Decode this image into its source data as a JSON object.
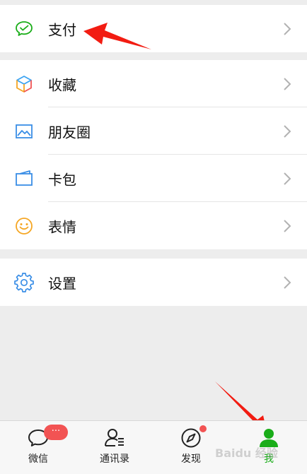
{
  "groups": [
    {
      "items": [
        {
          "label": "支付",
          "icon": "wechat-pay-icon"
        }
      ]
    },
    {
      "items": [
        {
          "label": "收藏",
          "icon": "favorites-cube-icon"
        },
        {
          "label": "朋友圈",
          "icon": "moments-picture-icon"
        },
        {
          "label": "卡包",
          "icon": "card-wallet-icon"
        },
        {
          "label": "表情",
          "icon": "smiley-face-icon"
        }
      ]
    },
    {
      "items": [
        {
          "label": "设置",
          "icon": "gear-icon"
        }
      ]
    }
  ],
  "tabs": [
    {
      "label": "微信",
      "icon": "chat-bubble-icon",
      "badge": "···"
    },
    {
      "label": "通讯录",
      "icon": "contacts-icon"
    },
    {
      "label": "发现",
      "icon": "compass-icon",
      "dot": true
    },
    {
      "label": "我",
      "icon": "person-icon",
      "active": true
    }
  ],
  "colors": {
    "accent": "#1aad19",
    "badge": "#f25353",
    "arrow": "#f21c12"
  },
  "watermark": "Baidu 经验"
}
